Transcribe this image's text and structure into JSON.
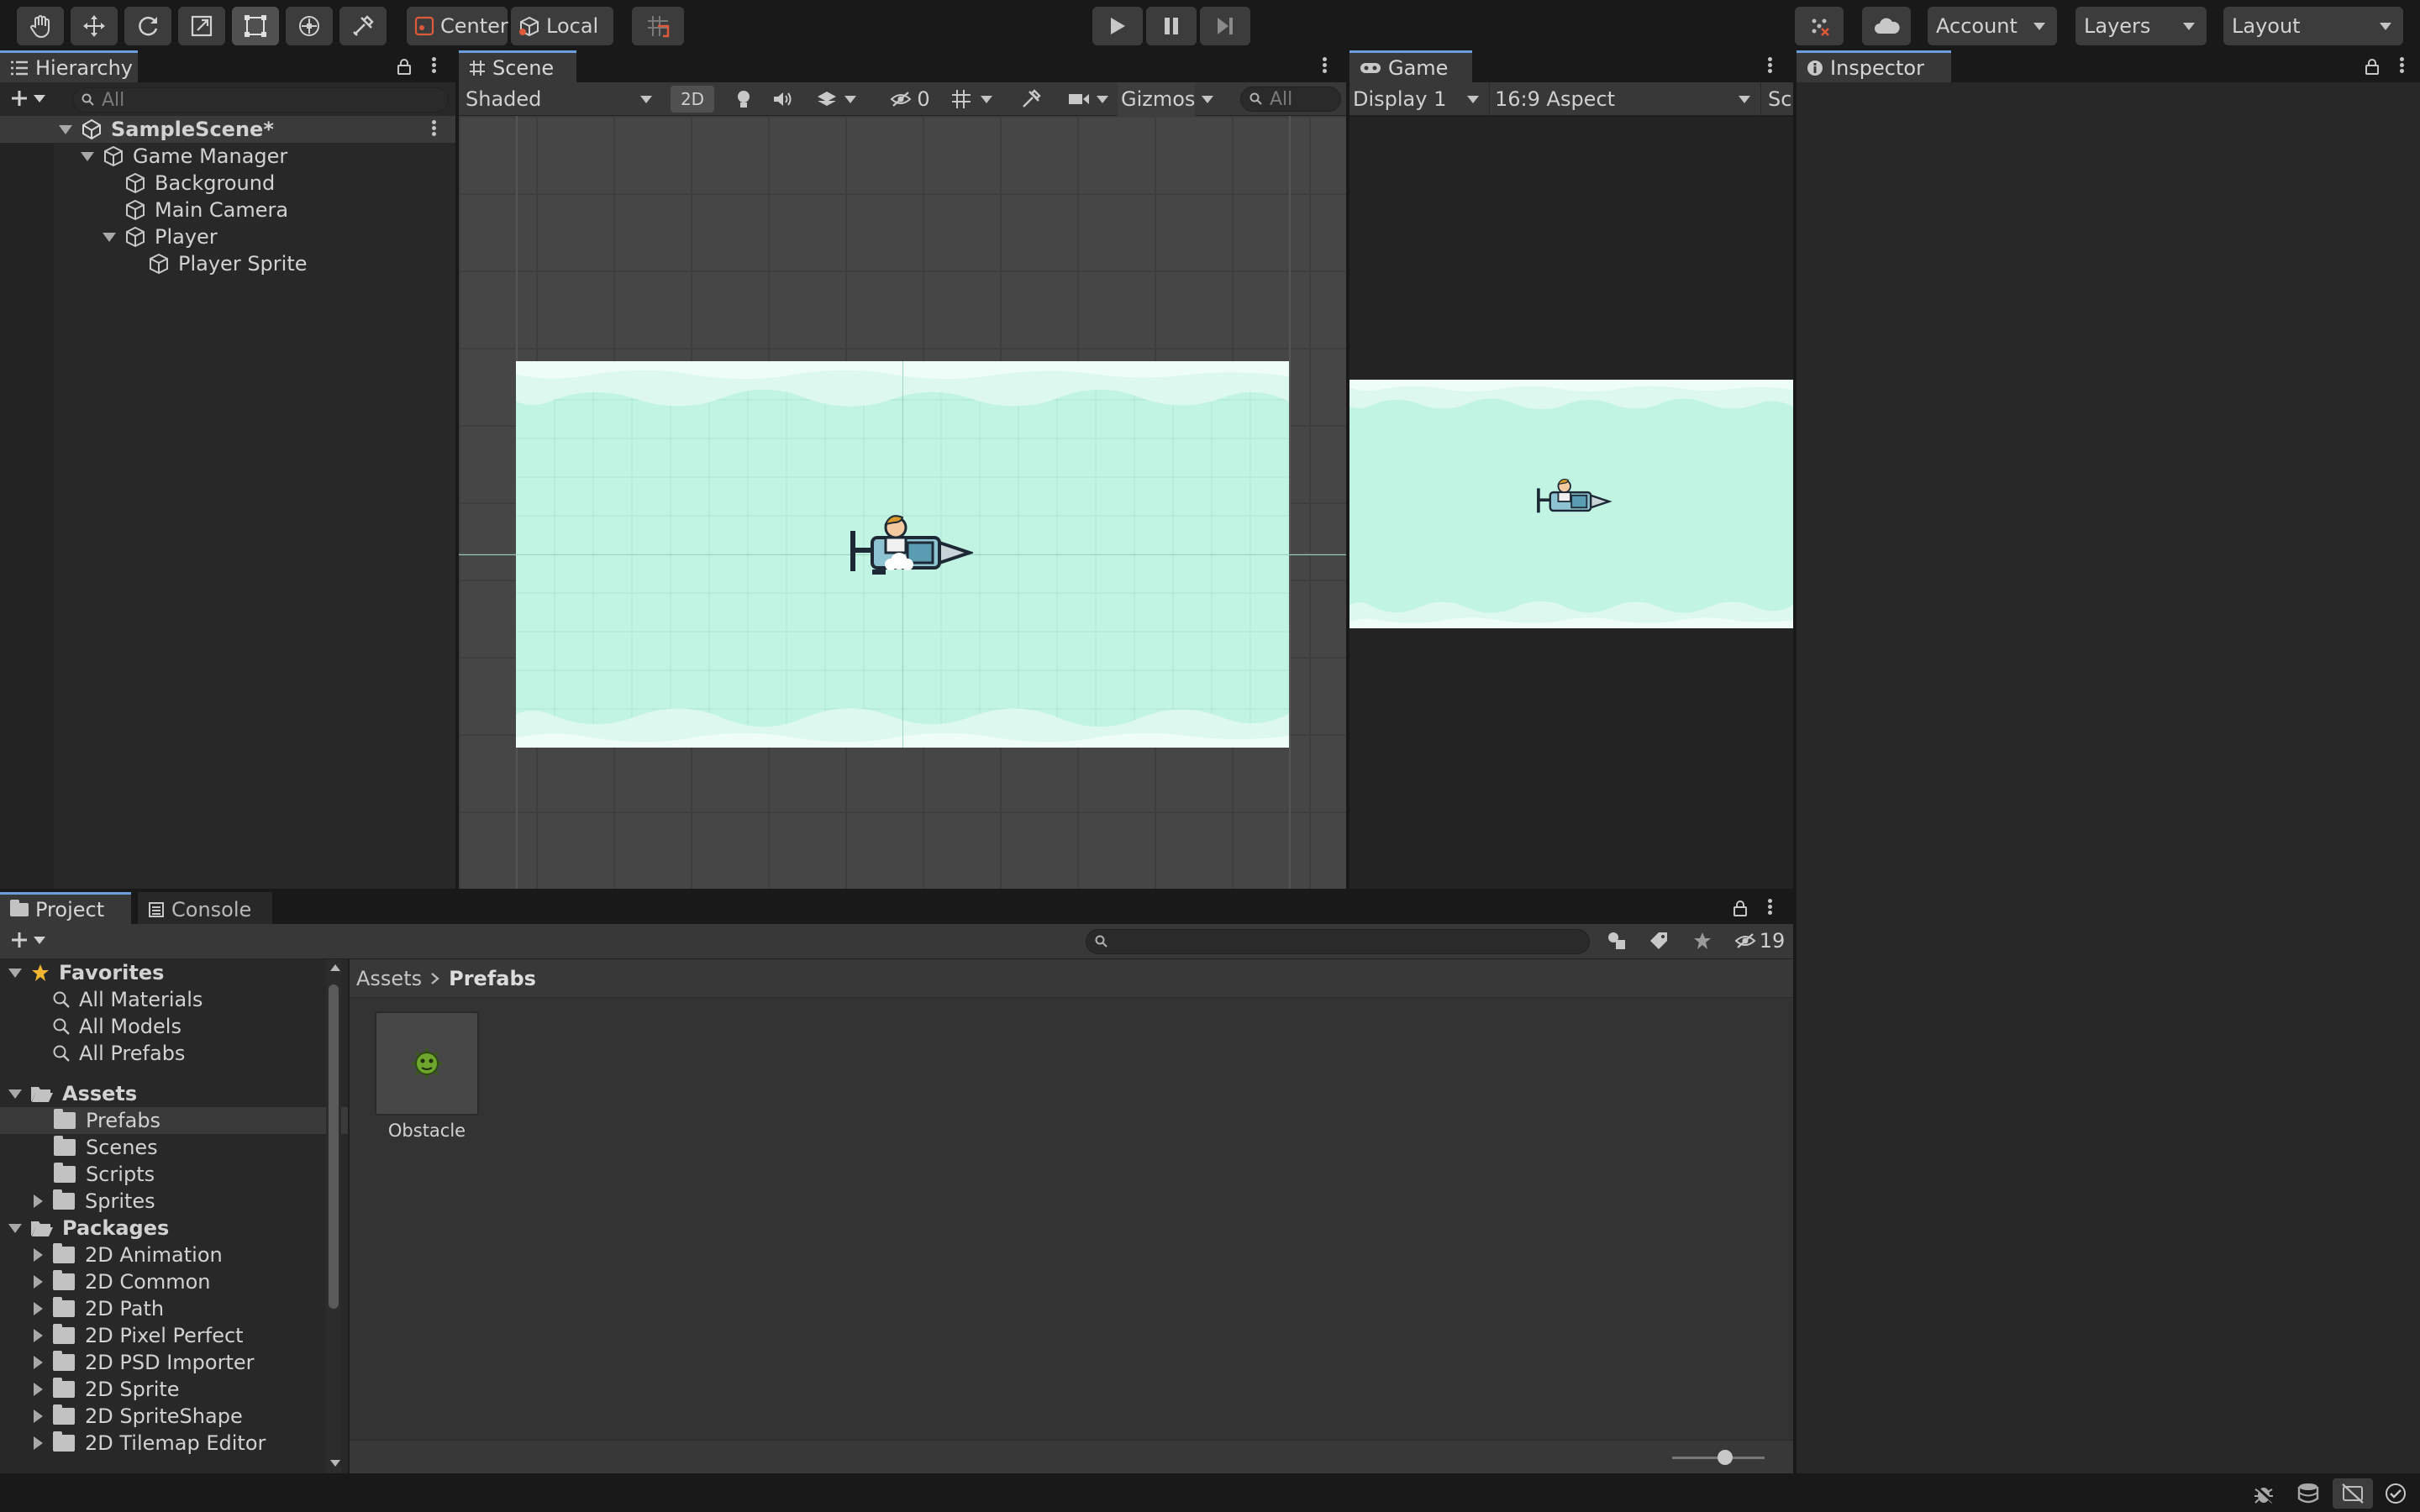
{
  "toolbar": {
    "pivot_label": "Center",
    "space_label": "Local",
    "account_label": "Account",
    "layers_label": "Layers",
    "layout_label": "Layout"
  },
  "hierarchy": {
    "tab_label": "Hierarchy",
    "search_placeholder": "All",
    "scene_name": "SampleScene*",
    "items": [
      {
        "label": "Game Manager"
      },
      {
        "label": "Background"
      },
      {
        "label": "Main Camera"
      },
      {
        "label": "Player"
      },
      {
        "label": "Player Sprite"
      }
    ]
  },
  "scene": {
    "tab_label": "Scene",
    "draw_mode": "Shaded",
    "mode_2d": "2D",
    "hidden_count": "0",
    "gizmos_label": "Gizmos",
    "search_placeholder": "All"
  },
  "game": {
    "tab_label": "Game",
    "display": "Display 1",
    "aspect": "16:9 Aspect",
    "scale_cut": "Sc"
  },
  "inspector": {
    "tab_label": "Inspector"
  },
  "project": {
    "tab_label": "Project",
    "console_tab_label": "Console",
    "hidden_packages_count": "19",
    "favorites_label": "Favorites",
    "favorites": [
      {
        "label": "All Materials"
      },
      {
        "label": "All Models"
      },
      {
        "label": "All Prefabs"
      }
    ],
    "assets_label": "Assets",
    "assets_folders": [
      {
        "label": "Prefabs"
      },
      {
        "label": "Scenes"
      },
      {
        "label": "Scripts"
      },
      {
        "label": "Sprites"
      }
    ],
    "packages_label": "Packages",
    "packages": [
      {
        "label": "2D Animation"
      },
      {
        "label": "2D Common"
      },
      {
        "label": "2D Path"
      },
      {
        "label": "2D Pixel Perfect"
      },
      {
        "label": "2D PSD Importer"
      },
      {
        "label": "2D Sprite"
      },
      {
        "label": "2D SpriteShape"
      },
      {
        "label": "2D Tilemap Editor"
      }
    ],
    "breadcrumb": {
      "root": "Assets",
      "current": "Prefabs"
    },
    "grid_items": [
      {
        "label": "Obstacle"
      }
    ]
  },
  "colors": {
    "accent_tab": "#6c9ee0",
    "sky": "#c2f4e3",
    "cloud": "#e5fbf4",
    "obstacle_green": "#6ea52c"
  }
}
